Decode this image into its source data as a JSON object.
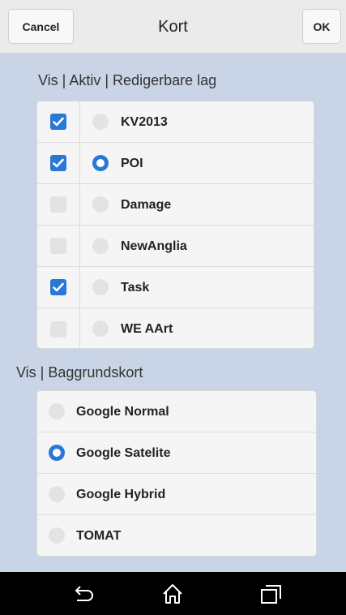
{
  "header": {
    "cancel_label": "Cancel",
    "title": "Kort",
    "ok_label": "OK"
  },
  "layers": {
    "heading": "Vis | Aktiv | Redigerbare lag",
    "items": [
      {
        "name": "KV2013",
        "visible": true,
        "active": false
      },
      {
        "name": "POI",
        "visible": true,
        "active": true
      },
      {
        "name": "Damage",
        "visible": false,
        "active": false
      },
      {
        "name": "NewAnglia",
        "visible": false,
        "active": false
      },
      {
        "name": "Task",
        "visible": true,
        "active": false
      },
      {
        "name": "WE AArt",
        "visible": false,
        "active": false
      }
    ]
  },
  "basemaps": {
    "heading": "Vis | Baggrundskort",
    "items": [
      {
        "name": "Google Normal",
        "selected": false
      },
      {
        "name": "Google Satelite",
        "selected": true
      },
      {
        "name": "Google Hybrid",
        "selected": false
      },
      {
        "name": "TOMAT",
        "selected": false
      }
    ]
  },
  "navbar": {
    "icons": [
      "back-icon",
      "home-icon",
      "recent-apps-icon"
    ]
  },
  "colors": {
    "accent": "#2a78d6",
    "background": "#c9d5e6",
    "header": "#ebebeb",
    "navbar": "#000000"
  }
}
